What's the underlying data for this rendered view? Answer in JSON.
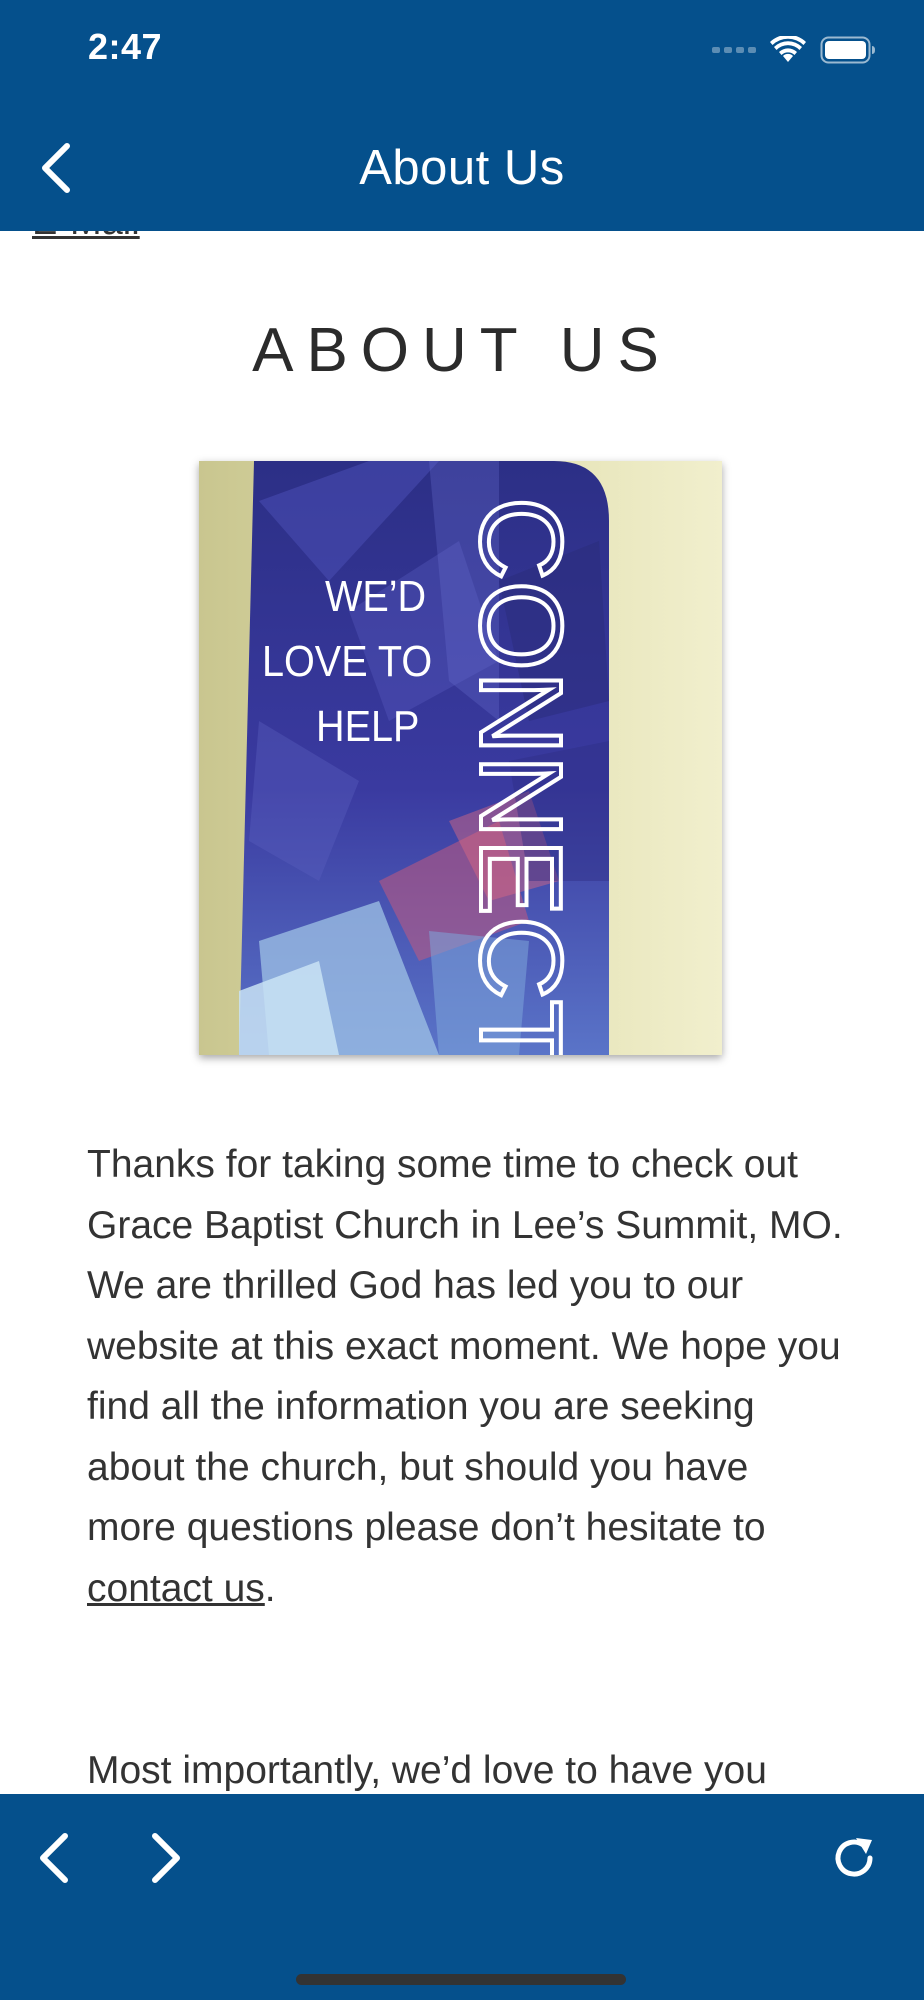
{
  "status_bar": {
    "time": "2:47"
  },
  "nav_bar": {
    "title": "About Us",
    "back_icon": "chevron-left-icon"
  },
  "content": {
    "partial_link": "E-Mail",
    "heading": "ABOUT US",
    "image": {
      "vertical_text": "CONNECT",
      "banner_lines": [
        "WE’D",
        "LOVE TO",
        "HELP"
      ]
    },
    "paragraph1": {
      "before_link": "Thanks for taking some time to check out Grace Baptist Church in Lee’s Summit, MO. We are thrilled God has led you to our website at this exact moment.  We hope you find all the information you are seeking about the church, but should you have more questions please don’t hesitate to ",
      "link": "contact us",
      "after_link": "."
    },
    "paragraph2_partial": "Most importantly, we’d love to have you"
  },
  "toolbar": {
    "back_icon": "chevron-left-icon",
    "forward_icon": "chevron-right-icon",
    "refresh_icon": "refresh-icon"
  },
  "colors": {
    "bar": "#05508c",
    "text": "#333333"
  }
}
